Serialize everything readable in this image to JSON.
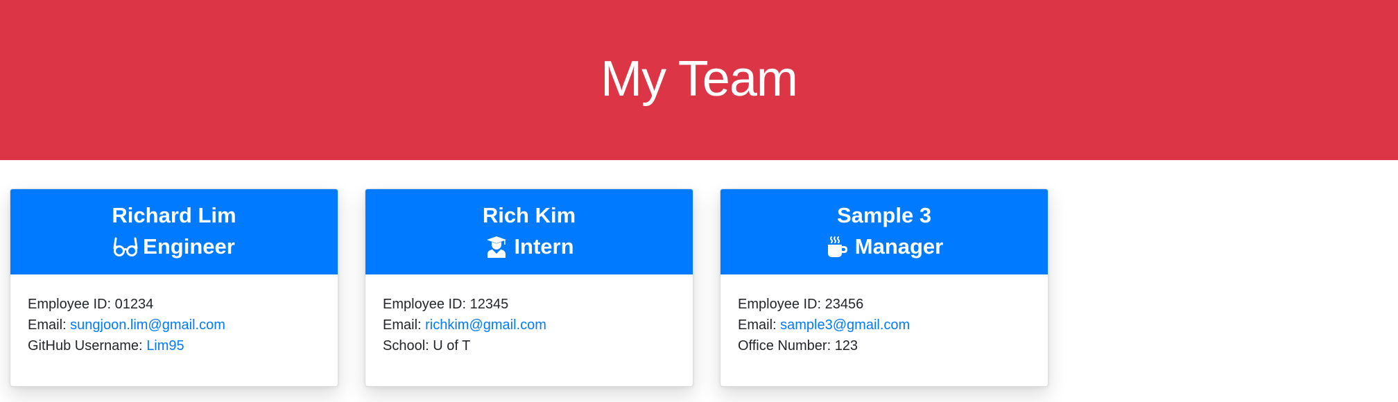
{
  "header": {
    "title": "My Team",
    "background": "#dc3545"
  },
  "accent_color": "#007bff",
  "cards": [
    {
      "name": "Richard Lim",
      "role": "Engineer",
      "role_icon": "glasses-icon",
      "id_label": "Employee ID:",
      "id_value": "01234",
      "email_label": "Email:",
      "email_value": "sungjoon.lim@gmail.com",
      "extra_label": "GitHub Username:",
      "extra_value": "Lim95"
    },
    {
      "name": "Rich Kim",
      "role": "Intern",
      "role_icon": "graduate-icon",
      "id_label": "Employee ID:",
      "id_value": "12345",
      "email_label": "Email:",
      "email_value": "richkim@gmail.com",
      "extra_label": "School:",
      "extra_value": "U of T"
    },
    {
      "name": "Sample 3",
      "role": "Manager",
      "role_icon": "coffee-mug-icon",
      "id_label": "Employee ID:",
      "id_value": "23456",
      "email_label": "Email:",
      "email_value": "sample3@gmail.com",
      "extra_label": "Office Number:",
      "extra_value": "123"
    }
  ]
}
